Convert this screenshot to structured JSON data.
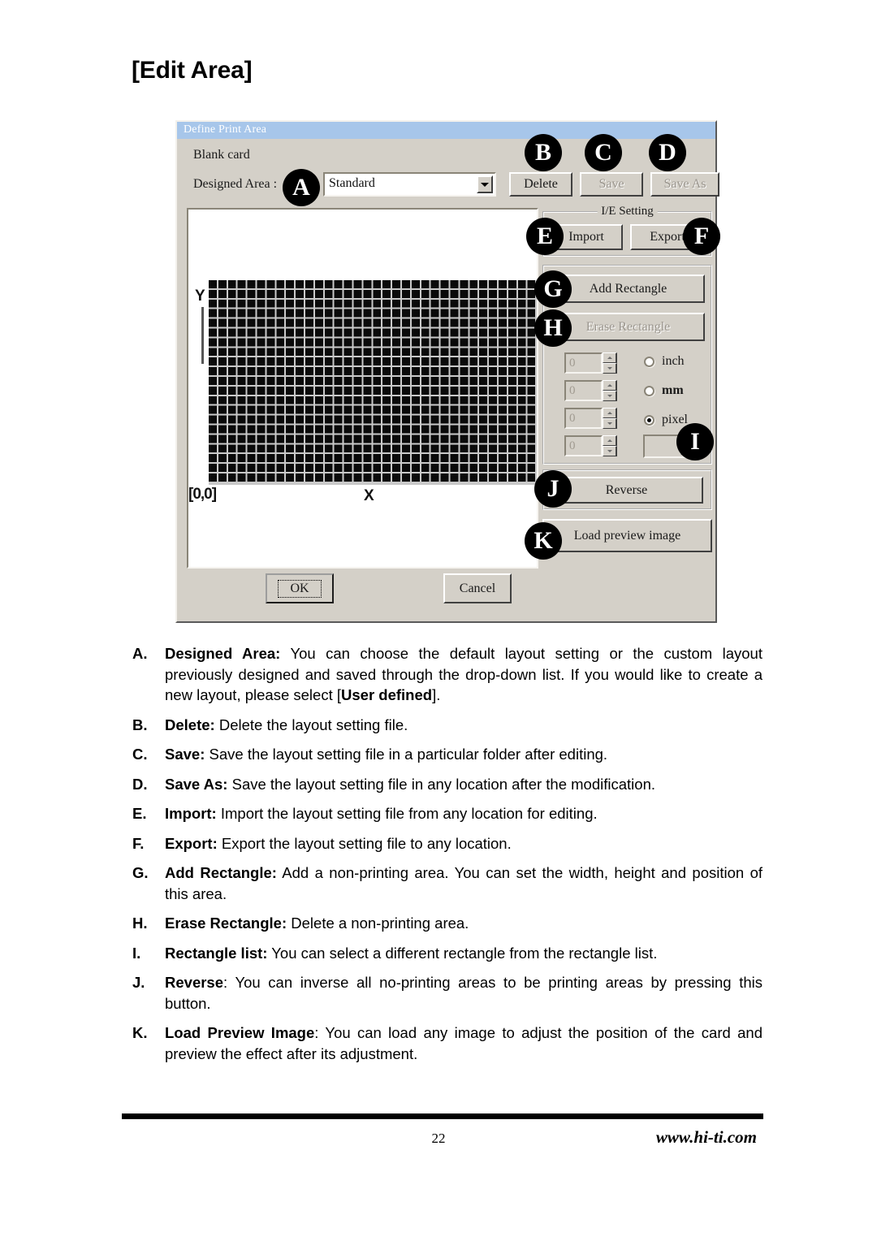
{
  "page": {
    "heading": "[Edit Area]",
    "number": "22",
    "website": "www.hi-ti.com"
  },
  "dialog": {
    "title": "Define Print Area",
    "blank_card_label": "Blank card",
    "designed_area_label": "Designed Area :",
    "designed_area_value": "Standard",
    "buttons": {
      "delete": "Delete",
      "save": "Save",
      "save_as": "Save As",
      "import": "Import",
      "export": "Export",
      "add_rectangle": "Add Rectangle",
      "erase_rectangle": "Erase Rectangle",
      "reverse": "Reverse",
      "load_preview_image": "Load preview image",
      "ok": "OK",
      "cancel": "Cancel"
    },
    "ie_setting_legend": "I/E Setting",
    "canvas": {
      "origin_label": "[0,0]",
      "x_axis_label": "X",
      "y_axis_label": "Y"
    },
    "spinners": [
      {
        "value": "0"
      },
      {
        "value": "0"
      },
      {
        "value": "0"
      },
      {
        "value": "0"
      }
    ],
    "units": [
      {
        "label": "inch",
        "selected": false
      },
      {
        "label": "mm",
        "selected": false
      },
      {
        "label": "pixel",
        "selected": true
      }
    ],
    "rectangle_list_value": ""
  },
  "callouts": {
    "a": "A",
    "b": "B",
    "c": "C",
    "d": "D",
    "e": "E",
    "f": "F",
    "g": "G",
    "h": "H",
    "i": "I",
    "j": "J",
    "k": "K"
  },
  "descriptions": [
    {
      "key": "A.",
      "term": "Designed Area:",
      "text_before": " You can choose the default layout setting or the custom layout previously designed and saved through the drop-down list. If you would like to create a new layout, please select [",
      "emphasis": "User defined",
      "text_after": "]."
    },
    {
      "key": "B.",
      "term": "Delete:",
      "text_before": " Delete the layout setting file.",
      "emphasis": "",
      "text_after": ""
    },
    {
      "key": "C.",
      "term": "Save:",
      "text_before": " Save the layout setting file in a particular folder after editing.",
      "emphasis": "",
      "text_after": ""
    },
    {
      "key": "D.",
      "term": "Save As:",
      "text_before": " Save the layout setting file in any location after the modification.",
      "emphasis": "",
      "text_after": ""
    },
    {
      "key": "E.",
      "term": "Import:",
      "text_before": " Import the layout setting file from any location for editing.",
      "emphasis": "",
      "text_after": ""
    },
    {
      "key": "F.",
      "term": "Export:",
      "text_before": " Export the layout setting file to any location.",
      "emphasis": "",
      "text_after": ""
    },
    {
      "key": "G.",
      "term": "Add Rectangle:",
      "text_before": " Add a non-printing area. You can set the width, height and position of this area.",
      "emphasis": "",
      "text_after": ""
    },
    {
      "key": "H.",
      "term": "Erase Rectangle:",
      "text_before": " Delete a non-printing area.",
      "emphasis": "",
      "text_after": ""
    },
    {
      "key": "I.",
      "term": "Rectangle list:",
      "text_before": " You can select a different rectangle from the rectangle list.",
      "emphasis": "",
      "text_after": ""
    },
    {
      "key": "J.",
      "term": "Reverse",
      "text_before": ": You can inverse all no-printing areas to be printing areas by pressing this button.",
      "emphasis": "",
      "text_after": ""
    },
    {
      "key": "K.",
      "term": "Load Preview Image",
      "text_before": ": You can load any image to adjust the position of the card and preview the effect after its adjustment.",
      "emphasis": "",
      "text_after": ""
    }
  ]
}
